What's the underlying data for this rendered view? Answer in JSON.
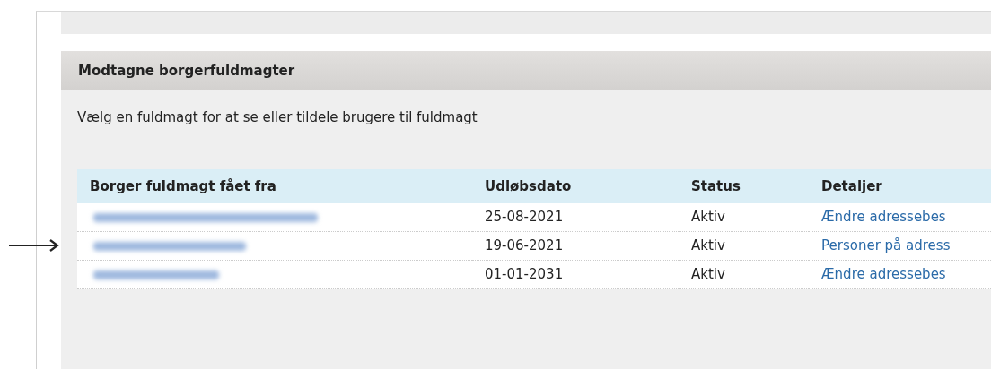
{
  "panel": {
    "title": "Modtagne borgerfuldmagter",
    "intro": "Vælg en fuldmagt for at se eller tildele brugere til fuldmagt"
  },
  "table": {
    "columns": [
      "Borger fuldmagt fået fra",
      "Udløbsdato",
      "Status",
      "Detaljer"
    ],
    "rows": [
      {
        "name_redacted": true,
        "date": "25-08-2021",
        "status": "Aktiv",
        "details": "Ændre adressebes",
        "pointed": false
      },
      {
        "name_redacted": true,
        "date": "19-06-2021",
        "status": "Aktiv",
        "details": "Personer på adress",
        "pointed": true
      },
      {
        "name_redacted": true,
        "date": "01-01-2031",
        "status": "Aktiv",
        "details": "Ændre adressebes",
        "pointed": false
      }
    ]
  }
}
